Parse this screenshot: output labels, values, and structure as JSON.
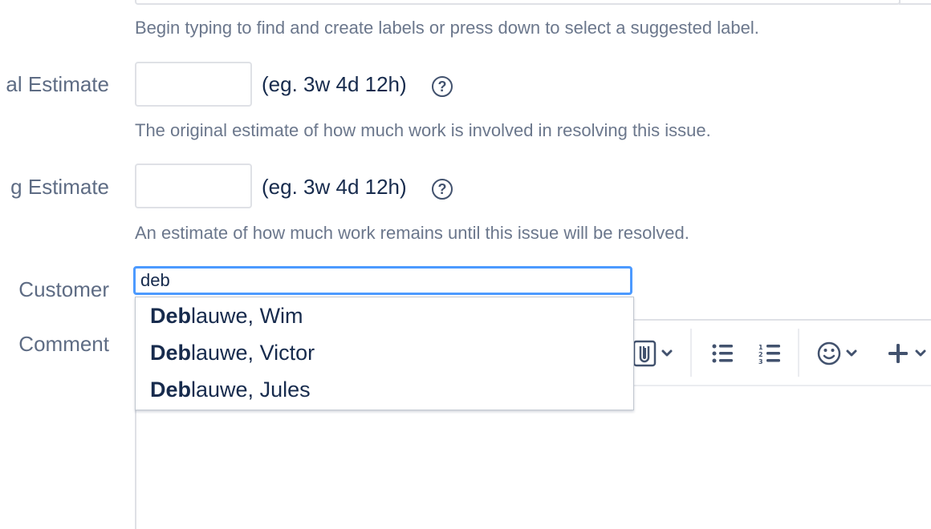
{
  "labels_field": {
    "help": "Begin typing to find and create labels or press down to select a suggested label."
  },
  "original_estimate": {
    "label": "al Estimate",
    "value": "",
    "hint": "(eg. 3w 4d 12h)",
    "help": "The original estimate of how much work is involved in resolving this issue."
  },
  "remaining_estimate": {
    "label": "g Estimate",
    "value": "",
    "hint": "(eg. 3w 4d 12h)",
    "help": "An estimate of how much work remains until this issue will be resolved."
  },
  "customer": {
    "label": "Customer",
    "value": "deb",
    "suggestions": [
      {
        "match": "Deb",
        "rest": "lauwe, Wim"
      },
      {
        "match": "Deb",
        "rest": "lauwe, Victor"
      },
      {
        "match": "Deb",
        "rest": "lauwe, Jules"
      }
    ]
  },
  "comment": {
    "label": "Comment",
    "toolbar_icons": [
      "attachment-icon",
      "bullet-list-icon",
      "numbered-list-icon",
      "emoji-icon",
      "insert-plus-icon"
    ]
  },
  "colors": {
    "focus_border": "#4c9aff",
    "label_text": "#5e6c84",
    "body_text": "#172b4d",
    "help_text": "#6b778c"
  }
}
